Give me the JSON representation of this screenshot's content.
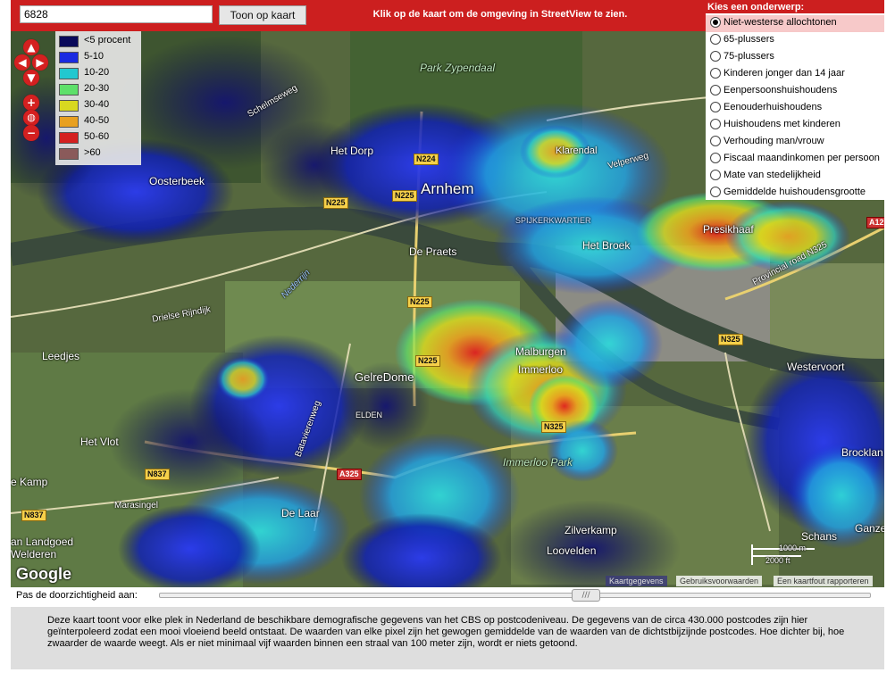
{
  "search": {
    "value": "6828",
    "button_label": "Toon op kaart"
  },
  "hint": "Klik op de kaart om de omgeving in StreetView te zien.",
  "legend": [
    {
      "label": "<5 procent",
      "color": "#0a0a5a"
    },
    {
      "label": "5-10",
      "color": "#1a2ae0"
    },
    {
      "label": "10-20",
      "color": "#22c8d0"
    },
    {
      "label": "20-30",
      "color": "#5ee06a"
    },
    {
      "label": "30-40",
      "color": "#d8d820"
    },
    {
      "label": "40-50",
      "color": "#e8a020"
    },
    {
      "label": "50-60",
      "color": "#d42020"
    },
    {
      "label": ">60",
      "color": "#8a5a5a"
    }
  ],
  "subject": {
    "title": "Kies een onderwerp:",
    "options": [
      {
        "label": "Niet-westerse allochtonen",
        "selected": true
      },
      {
        "label": "65-plussers",
        "selected": false
      },
      {
        "label": "75-plussers",
        "selected": false
      },
      {
        "label": "Kinderen jonger dan 14 jaar",
        "selected": false
      },
      {
        "label": "Eenpersoonshuishoudens",
        "selected": false
      },
      {
        "label": "Eenouderhuishoudens",
        "selected": false
      },
      {
        "label": "Huishoudens met kinderen",
        "selected": false
      },
      {
        "label": "Verhouding man/vrouw",
        "selected": false
      },
      {
        "label": "Fiscaal maandinkomen per persoon",
        "selected": false
      },
      {
        "label": "Mate van stedelijkheid",
        "selected": false
      },
      {
        "label": "Gemiddelde huishoudensgrootte",
        "selected": false
      }
    ]
  },
  "map": {
    "places": {
      "arnhem": "Arnhem",
      "park_zypendaal": "Park\nZypendaal",
      "het_dorp": "Het Dorp",
      "oosterbeek": "Oosterbeek",
      "de_praets": "De Praets",
      "gelredome": "GelreDome",
      "leedjes": "Leedjes",
      "het_vlot": "Het Vlot",
      "kamp": "e Kamp",
      "landgoed": "an Landgoed\nWelderen",
      "immerloo_park": "Immerloo Park",
      "zilverkamp": "Zilverkamp",
      "loovelden": "Loovelden",
      "westervoort": "Westervoort",
      "brocklan": "Brocklan",
      "ganzenp": "Ganzenp",
      "schans": "Schans",
      "spijkerkwartier": "SPIJKERKWARTIER",
      "malburgen": "Malburgen",
      "immerloo": "Immerloo",
      "presikhaaf": "Presikhaaf",
      "het_broek": "Het Broek",
      "elden": "ELDEN",
      "de_laar": "De Laar",
      "klarendal": "Klarendal"
    },
    "roads": {
      "n224": "N224",
      "n225a": "N225",
      "n225b": "N225",
      "n225c": "N225",
      "n225d": "N225",
      "n325a": "N325",
      "n325b": "N325",
      "n837a": "N837",
      "n837b": "N837",
      "a325": "A325",
      "a12": "A12"
    },
    "street_labels": {
      "schelmseweg": "Schelmseweg",
      "drielse": "Drielse Rijndijk",
      "batavierenweg": "Batavierenweg",
      "provincial": "Provincial road N325",
      "nederrijn": "Nederrijn",
      "velperweg": "Velperweg",
      "marasingel": "Marasingel"
    },
    "scale": {
      "m": "1000 m",
      "ft": "2000 ft"
    },
    "google": "Google",
    "footer": [
      "Kaartgegevens",
      "Gebruiksvoorwaarden",
      "Een kaartfout rapporteren"
    ]
  },
  "opacity_label": "Pas de doorzichtigheid aan:",
  "description": "Deze kaart toont voor elke plek in Nederland de beschikbare demografische gegevens van het CBS op postcodeniveau. De gegevens van de circa 430.000 postcodes zijn hier geïnterpoleerd zodat een mooi vloeiend beeld ontstaat. De waarden van elke pixel zijn het gewogen gemiddelde van de waarden van de dichtstbijzijnde postcodes. Hoe dichter bij, hoe zwaarder de waarde weegt. Als er niet minimaal vijf waarden binnen een straal van 100 meter zijn, wordt er niets getoond."
}
